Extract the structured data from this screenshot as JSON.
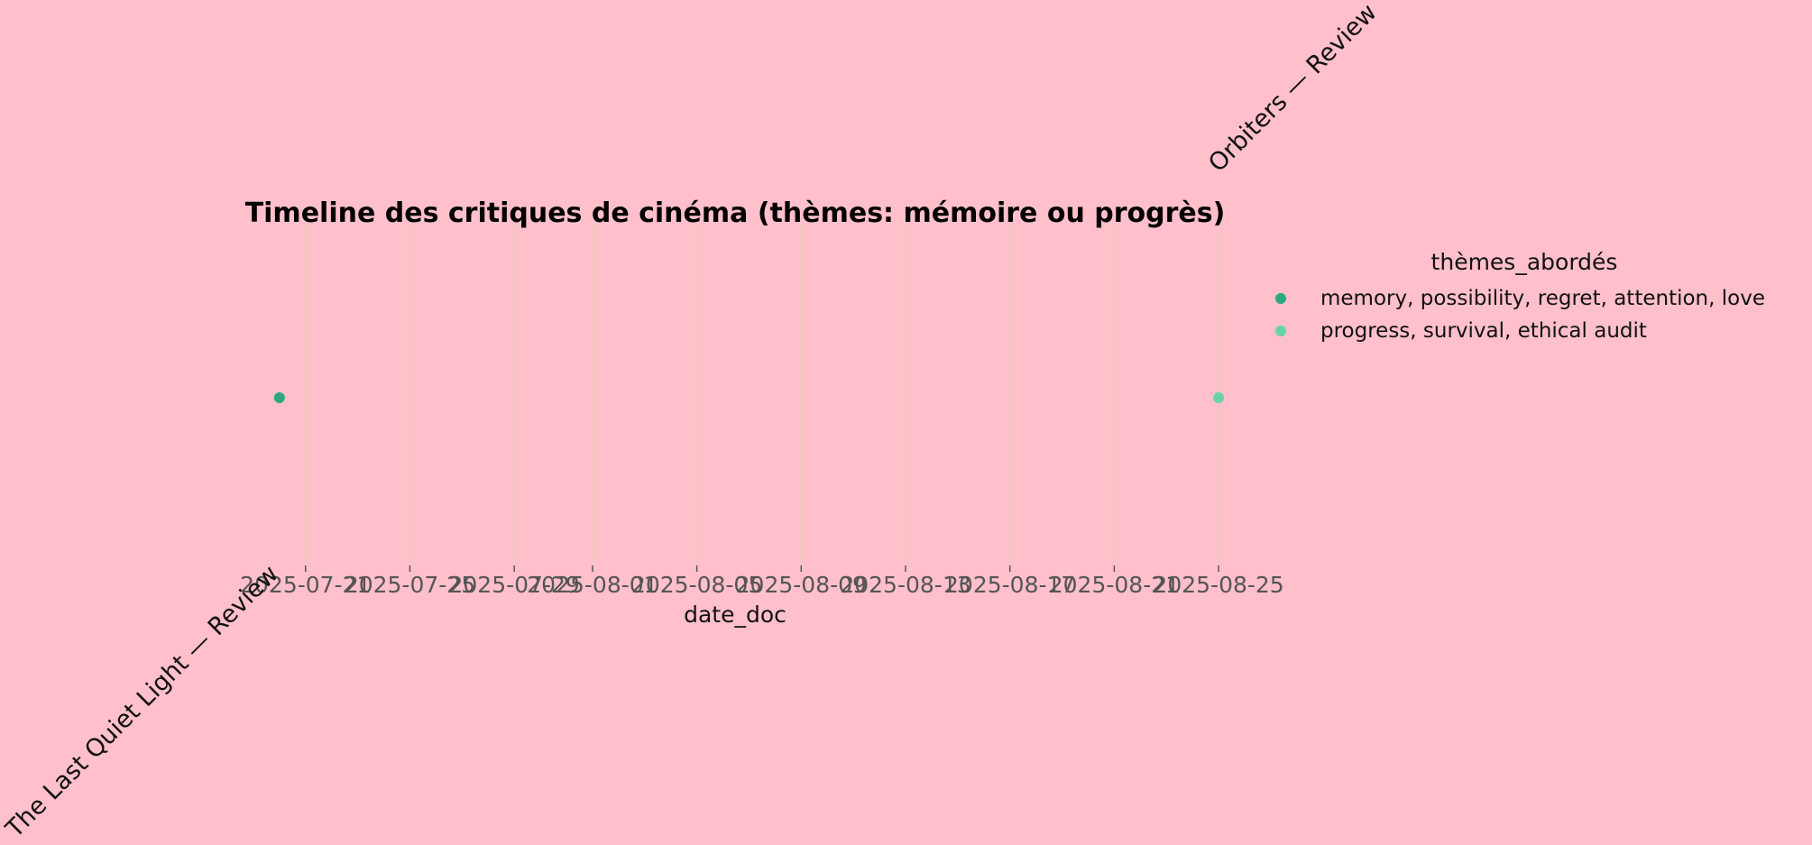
{
  "chart_data": {
    "type": "scatter",
    "title": "Timeline des critiques de cinéma (thèmes: mémoire ou progrès)",
    "xlabel": "date_doc",
    "ylabel": "",
    "x_type": "date",
    "xlim": [
      "2025-07-18",
      "2025-08-26"
    ],
    "x_ticks": [
      "2025-07-21",
      "2025-07-25",
      "2025-07-29",
      "2025-08-01",
      "2025-08-05",
      "2025-08-09",
      "2025-08-13",
      "2025-08-17",
      "2025-08-21",
      "2025-08-25"
    ],
    "grid": true,
    "legend": {
      "title": "thèmes_abordés",
      "placement": "outside-right"
    },
    "series": [
      {
        "name": "memory, possibility, regret, attention, love",
        "color": "#2ca87f",
        "points": [
          {
            "x": "2025-07-20",
            "label": "The Last Quiet Light — Review"
          }
        ]
      },
      {
        "name": "progress, survival, ethical audit",
        "color": "#66d4a6",
        "points": [
          {
            "x": "2025-08-25",
            "label": "Orbiters — Review"
          }
        ]
      }
    ]
  }
}
